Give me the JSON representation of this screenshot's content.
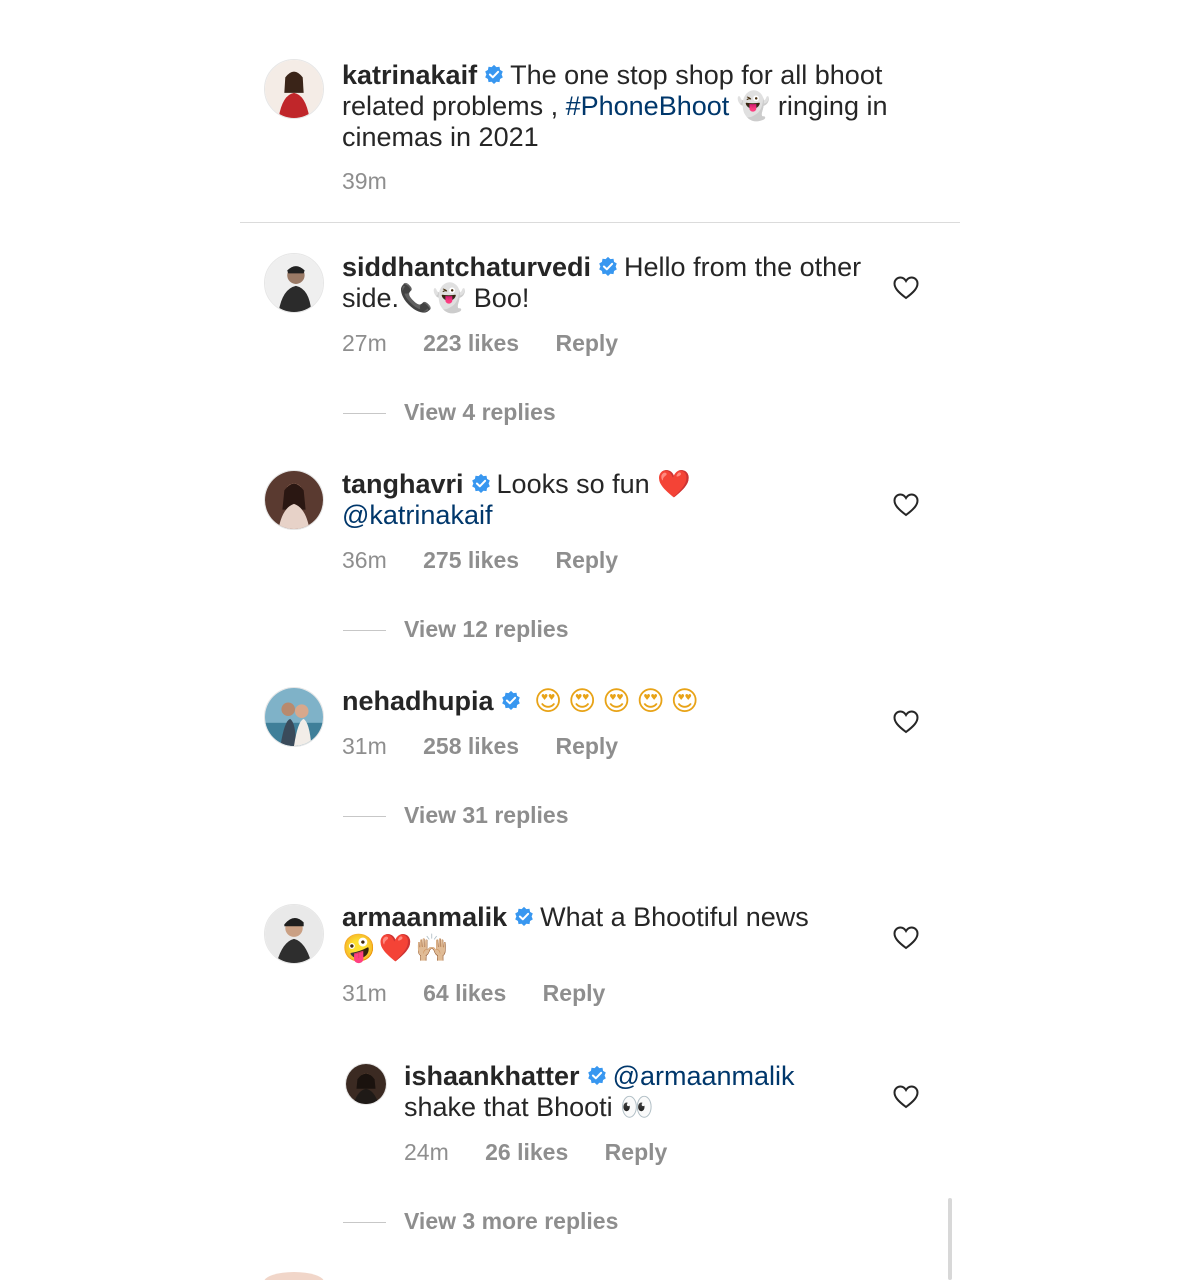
{
  "caption": {
    "username": "katrinakaif",
    "text_before_tag": "The one stop shop for all bhoot related problems , ",
    "hashtag": "#PhoneBhoot",
    "ghost_emoji": "👻",
    "text_after": " ringing in cinemas in 2021",
    "time": "39m"
  },
  "comments": [
    {
      "username": "siddhantchaturvedi",
      "text": "Hello from the other side.",
      "emoji": "📞👻",
      "text_after": " Boo!",
      "time": "27m",
      "likes": "223 likes",
      "reply": "Reply",
      "view_replies": "View 4 replies"
    },
    {
      "username": "tanghavri",
      "text": "Looks so fun ",
      "emoji": "❤️",
      "mention": "@katrinakaif",
      "time": "36m",
      "likes": "275 likes",
      "reply": "Reply",
      "view_replies": "View 12 replies"
    },
    {
      "username": "nehadhupia",
      "emoji": "😍😍😍😍😍",
      "time": "31m",
      "likes": "258 likes",
      "reply": "Reply",
      "view_replies": "View 31 replies"
    },
    {
      "username": "armaanmalik",
      "text": "What a Bhootiful news",
      "emoji": "🤪❤️🙌🏼",
      "time": "31m",
      "likes": "64 likes",
      "reply": "Reply"
    }
  ],
  "nested_reply": {
    "username": "ishaankhatter",
    "mention": "@armaanmalik",
    "text": "shake that Bhooti ",
    "emoji": "👀",
    "time": "24m",
    "likes": "26 likes",
    "reply": "Reply",
    "view_more": "View 3 more replies"
  },
  "colors": {
    "text": "#262626",
    "secondary": "#8e8e8e",
    "link": "#00376b",
    "verified": "#3897f0",
    "divider": "#dbdbdb"
  },
  "icons": [
    "verified-badge-icon",
    "heart-icon"
  ]
}
